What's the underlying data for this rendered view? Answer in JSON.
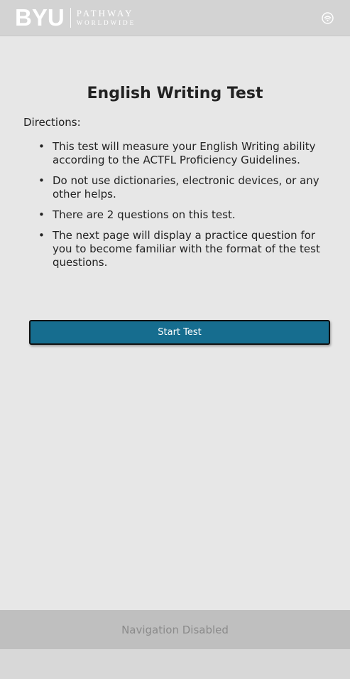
{
  "header": {
    "logo_byu": "BYU",
    "logo_pathway": "PATHWAY",
    "logo_worldwide": "WORLDWIDE",
    "status_icon": "wifi-icon"
  },
  "main": {
    "title": "English Writing Test",
    "directions_label": "Directions:",
    "bullets": [
      "This test will measure your English Writing ability according to the ACTFL Proficiency Guidelines.",
      "Do not use dictionaries, electronic devices, or any other helps.",
      "There are 2 questions on this test.",
      "The next page will display a practice question for you to become familiar with the format of the test questions."
    ],
    "start_button_label": "Start Test"
  },
  "footer": {
    "navigation_label": "Navigation Disabled"
  },
  "colors": {
    "header_bg": "#d3d3d3",
    "content_bg": "#e7e7e7",
    "button_bg": "#166d8f",
    "footer_bg": "#bfbfbf"
  }
}
